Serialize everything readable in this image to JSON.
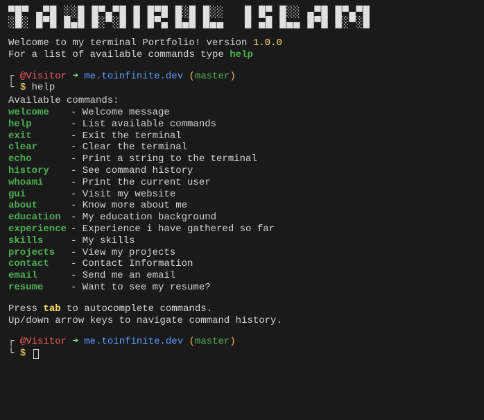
{
  "ascii_title": "▀█▀ ▄▀█ ░░█ █▀▄▀█ █ █▀█ █░█ █░░   █ █▀ █░░ ▄▀█ █▀▄▀█\n░█░ █▀█ █▄█ █░▀░█ █ █▀▄ █▄█ █▄▄   █ ▄█ █▄▄ █▀█ █░▀░█",
  "welcome": {
    "line1_prefix": "Welcome to my terminal Portfolio! version ",
    "version": "1.0.0",
    "line2_prefix": "For a list of available commands type ",
    "help_word": "help"
  },
  "prompt": {
    "visitor": "@Visitor",
    "arrow": "➜",
    "host": "me.toinfinite.dev",
    "paren_open": "(",
    "branch": "master",
    "paren_close": ")",
    "dollar": "$"
  },
  "entered_command": "help",
  "output_header": "Available commands:",
  "commands": [
    {
      "name": "welcome",
      "desc": "- Welcome message"
    },
    {
      "name": "help",
      "desc": "- List available commands"
    },
    {
      "name": "exit",
      "desc": "- Exit the terminal"
    },
    {
      "name": "clear",
      "desc": "- Clear the terminal"
    },
    {
      "name": "echo",
      "desc": "- Print a string to the terminal"
    },
    {
      "name": "history",
      "desc": "- See command history"
    },
    {
      "name": "whoami",
      "desc": "- Print the current user"
    },
    {
      "name": "gui",
      "desc": "- Visit my website"
    },
    {
      "name": "about",
      "desc": "- Know more about me"
    },
    {
      "name": "education",
      "desc": "- My education background"
    },
    {
      "name": "experience",
      "desc": "- Experience i have gathered so far"
    },
    {
      "name": "skills",
      "desc": "- My skills"
    },
    {
      "name": "projects",
      "desc": "- View my projects"
    },
    {
      "name": "contact",
      "desc": "- Contact Information"
    },
    {
      "name": "email",
      "desc": "- Send me an email"
    },
    {
      "name": "resume",
      "desc": "- Want to see my resume?"
    }
  ],
  "hints": {
    "line1_prefix": "Press ",
    "tab": "tab",
    "line1_suffix": " to autocomplete commands.",
    "line2": "Up/down arrow keys to navigate command history."
  }
}
